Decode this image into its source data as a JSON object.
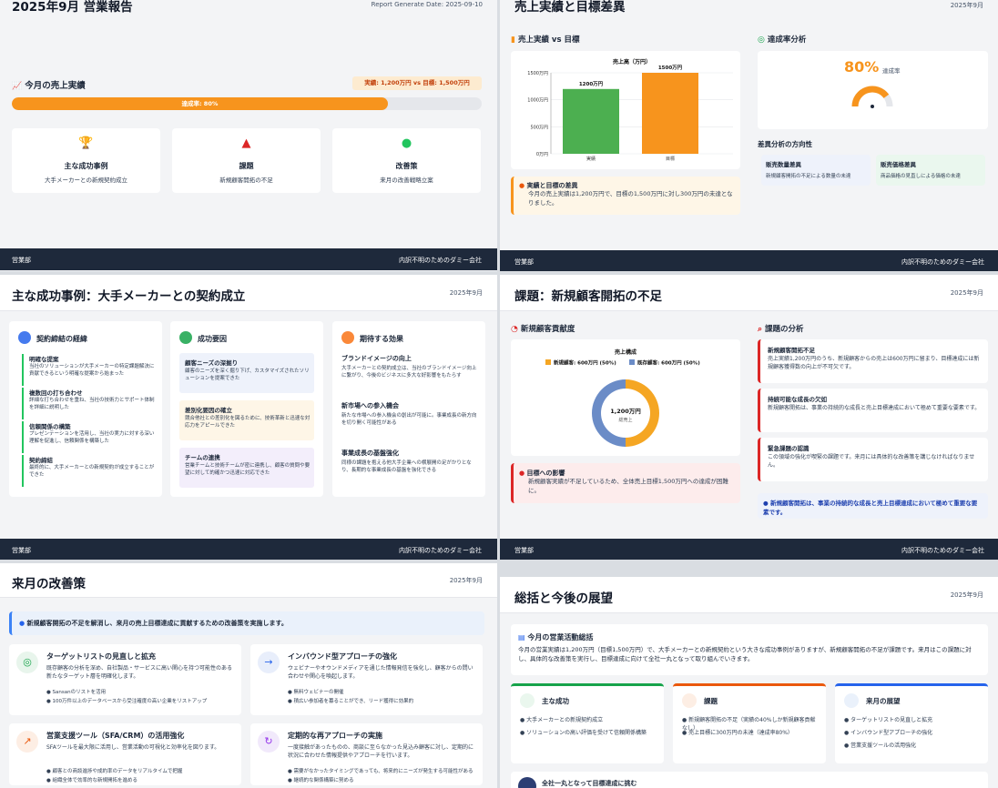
{
  "s1": {
    "title": "2025年9月 営業報告",
    "date": "Report Generate Date: 2025-09-10",
    "section": "今月の売上実績",
    "badge": "実績: 1,200万円  vs  目標: 1,500万円",
    "progress_label": "達成率: 80%",
    "progress": 0.8,
    "cards": [
      {
        "icon": "trophy-icon",
        "title": "主な成功事例",
        "text": "大手メーカーとの新規契約成立"
      },
      {
        "icon": "warning-icon",
        "title": "課題",
        "text": "新規顧客開拓の不足"
      },
      {
        "icon": "lightbulb-icon",
        "title": "改善策",
        "text": "来月の改善戦略立案"
      }
    ]
  },
  "footer": {
    "left": "営業部",
    "right": "内訳不明のためのダミー会社"
  },
  "s2": {
    "title": "売上実績と目標差異",
    "date": "2025年9月",
    "chart_section": "売上実績 vs 目標",
    "rate_section": "達成率分析",
    "rate_value": "80%",
    "rate_label": "達成率",
    "gap_title": "実績と目標の差異",
    "gap_text": "今月の売上実績は1,200万円で、目標の1,500万円に対し300万円の未達となりました。",
    "direction_title": "差異分析の方向性",
    "direction_items": [
      {
        "title": "販売数量差異",
        "text": "新規顧客開拓の不足による数量の未達"
      },
      {
        "title": "販売価格差異",
        "text": "商品価格の見直しによる価格の未達"
      }
    ]
  },
  "chart_data": [
    {
      "type": "bar",
      "title": "売上高（万円）",
      "categories": [
        "実績",
        "目標"
      ],
      "values": [
        1200,
        1500
      ],
      "data_labels": [
        "1200万円",
        "1500万円"
      ],
      "ytick_labels": [
        "0万円",
        "500万円",
        "1000万円",
        "1500万円"
      ],
      "ylim": [
        0,
        1500
      ],
      "colors": [
        "#4caf50",
        "#f7941d"
      ]
    },
    {
      "type": "pie",
      "title": "売上構成",
      "labels": [
        "新規顧客: 600万円 (50%)",
        "既存顧客: 600万円 (50%)"
      ],
      "values": [
        600,
        600
      ],
      "colors": [
        "#f5a623",
        "#6b8cc7"
      ],
      "center_value": "1,200万円",
      "center_label": "総売上"
    }
  ],
  "s3": {
    "title": "主な成功事例：大手メーカーとの契約成立",
    "date": "2025年9月",
    "col1_title": "契約締結の経緯",
    "col1_items": [
      {
        "title": "明確な提案",
        "text": "当社のソリューションが大手メーカーの特定課題解決に貢献できるという明確な提案から始まった"
      },
      {
        "title": "複数回の打ち合わせ",
        "text": "詳細な打ち合わせを重ね、当社の技術力とサポート体制を詳細に説明した"
      },
      {
        "title": "信頼関係の構築",
        "text": "プレゼンテーションを活用し、当社の実力に対する深い理解を促進し、信頼関係を構築した"
      },
      {
        "title": "契約締結",
        "text": "最終的に、大手メーカーとの新規契約が成立することができた"
      }
    ],
    "col2_title": "成功要因",
    "col2_items": [
      {
        "title": "顧客ニーズの深掘り",
        "text": "顧客のニーズを深く掘り下げ、カスタマイズされたソリューションを提案できた"
      },
      {
        "title": "差別化要因の確立",
        "text": "競合他社との差別化を図るために、技術革新と迅速な対応力をアピールできた"
      },
      {
        "title": "チームの連携",
        "text": "営業チームと技術チームが密に連携し、顧客の質問や要望に対して的確かつ迅速に対応できた"
      }
    ],
    "col3_title": "期待する効果",
    "col3_items": [
      {
        "title": "ブランドイメージの向上",
        "text": "大手メーカーとの契約成立は、当社のブランドイメージ向上に繋がり、今後のビジネスに多大な好影響をもたらす"
      },
      {
        "title": "新市場への参入機会",
        "text": "新たな市場への参入機会の創出が可能に。事業成長の新方向を切り開く可能性がある"
      },
      {
        "title": "事業成長の基盤強化",
        "text": "同様の課題を抱える他大手企業への横展開の足がかりとなり、長期的な事業成長の基盤を強化できる"
      }
    ]
  },
  "s4": {
    "title": "課題：新規顧客開拓の不足",
    "date": "2025年9月",
    "left_section": "新規顧客貢献度",
    "right_section": "課題の分析",
    "impact_title": "目標への影響",
    "impact_text": "新規顧客実績が不足しているため、全体売上目標1,500万円への達成が困難に。",
    "analysis": [
      {
        "title": "新規顧客開拓不足",
        "text": "売上実績1,200万円のうち、新規顧客からの売上は600万円に留まり、目標達成には新規顧客獲得数の向上が不可欠です。"
      },
      {
        "title": "持続可能な成長の欠如",
        "text": "新規顧客開拓は、事業の持続的な成長と売上目標達成において極めて重要な要素です。"
      },
      {
        "title": "緊急課題の認識",
        "text": "この領域の強化が喫緊の課題です。来月には具体的な改善策を講じなければなりません。"
      }
    ],
    "note": "新規顧客開拓は、事業の持続的な成長と売上目標達成において極めて重要な要素です。"
  },
  "s5": {
    "title": "来月の改善策",
    "date": "2025年9月",
    "banner": "新規顧客開拓の不足を解消し、来月の売上目標達成に貢献するための改善策を実施します。",
    "items": [
      {
        "icon": "target-icon",
        "title": "ターゲットリストの見直しと拡充",
        "text": "既存顧客の分析を深め、自社製品・サービスに高い関心を持つ可能性のある新たなターゲット層を明確化します。",
        "points": [
          "Sansanのリストを活用",
          "100万件以上のデータベースから受注確度の高い企業をリストアップ"
        ]
      },
      {
        "icon": "inbound-icon",
        "title": "インバウンド型アプローチの強化",
        "text": "ウェビナーやオウンドメディアを通じた情報発信を強化し、顧客からの問い合わせや関心を喚起します。",
        "points": [
          "無料ウェビナーの開催",
          "積広い参加者を募ることができ、リード獲得に効果的"
        ]
      },
      {
        "icon": "chart-icon",
        "title": "営業支援ツール（SFA/CRM）の活用強化",
        "text": "SFAツールを最大限に活用し、営業活動の可視化と効率化を図ります。",
        "points": [
          "顧客との商談進捗や成約率のデータをリアルタイムで把握",
          "組織全体で効率的な新規開拓を進める"
        ]
      },
      {
        "icon": "refresh-icon",
        "title": "定期的な再アプローチの実施",
        "text": "一度接触があったものの、商談に至らなかった見込み顧客に対し、定期的に状況に合わせた情報提供やアプローチを行います。",
        "points": [
          "需要がなかったタイミングであっても、将来的にニーズが発生する可能性がある",
          "継続的な関係構築に努める"
        ]
      }
    ]
  },
  "s6": {
    "title": "総括と今後の展望",
    "date": "2025年9月",
    "summary_title": "今月の営業活動総括",
    "summary_text": "今月の営業実績は1,200万円（目標1,500万円）で、大手メーカーとの新規契約という大きな成功事例がありますが、新規顧客開拓の不足が課題です。来月はこの課題に対し、具体的な改善策を実行し、目標達成に向けて全社一丸となって取り組んでいきます。",
    "cols": [
      {
        "title": "主な成功",
        "items": [
          "大手メーカーとの新規契約成立",
          "ソリューションの高い評価を受けて信頼関係構築"
        ]
      },
      {
        "title": "課題",
        "items": [
          "新規顧客開拓の不足（実績の40%しか新規顧客貢献なし）",
          "売上目標に300万円の未達（達成率80%）"
        ]
      },
      {
        "title": "来月の展望",
        "items": [
          "ターゲットリストの見直しと拡充",
          "インバウンド型アプローチの強化",
          "営業支援ツールの活用強化"
        ]
      }
    ],
    "bottom": "全社一丸となって目標達成に挑む"
  }
}
